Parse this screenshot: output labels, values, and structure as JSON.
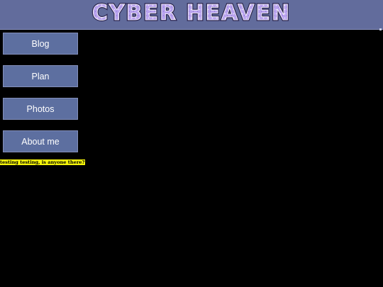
{
  "header": {
    "logo_text": "CYBER HEAVEN",
    "colors": {
      "bar": "#626c9c",
      "logo_fill": "#c9b7f2",
      "logo_stroke": "#ffffff"
    }
  },
  "nav": {
    "items": [
      {
        "label": "Blog"
      },
      {
        "label": "Plan"
      },
      {
        "label": "Photos"
      },
      {
        "label": "About me"
      }
    ]
  },
  "content": {
    "marquee_text": "testing testing, is anyone there?"
  }
}
